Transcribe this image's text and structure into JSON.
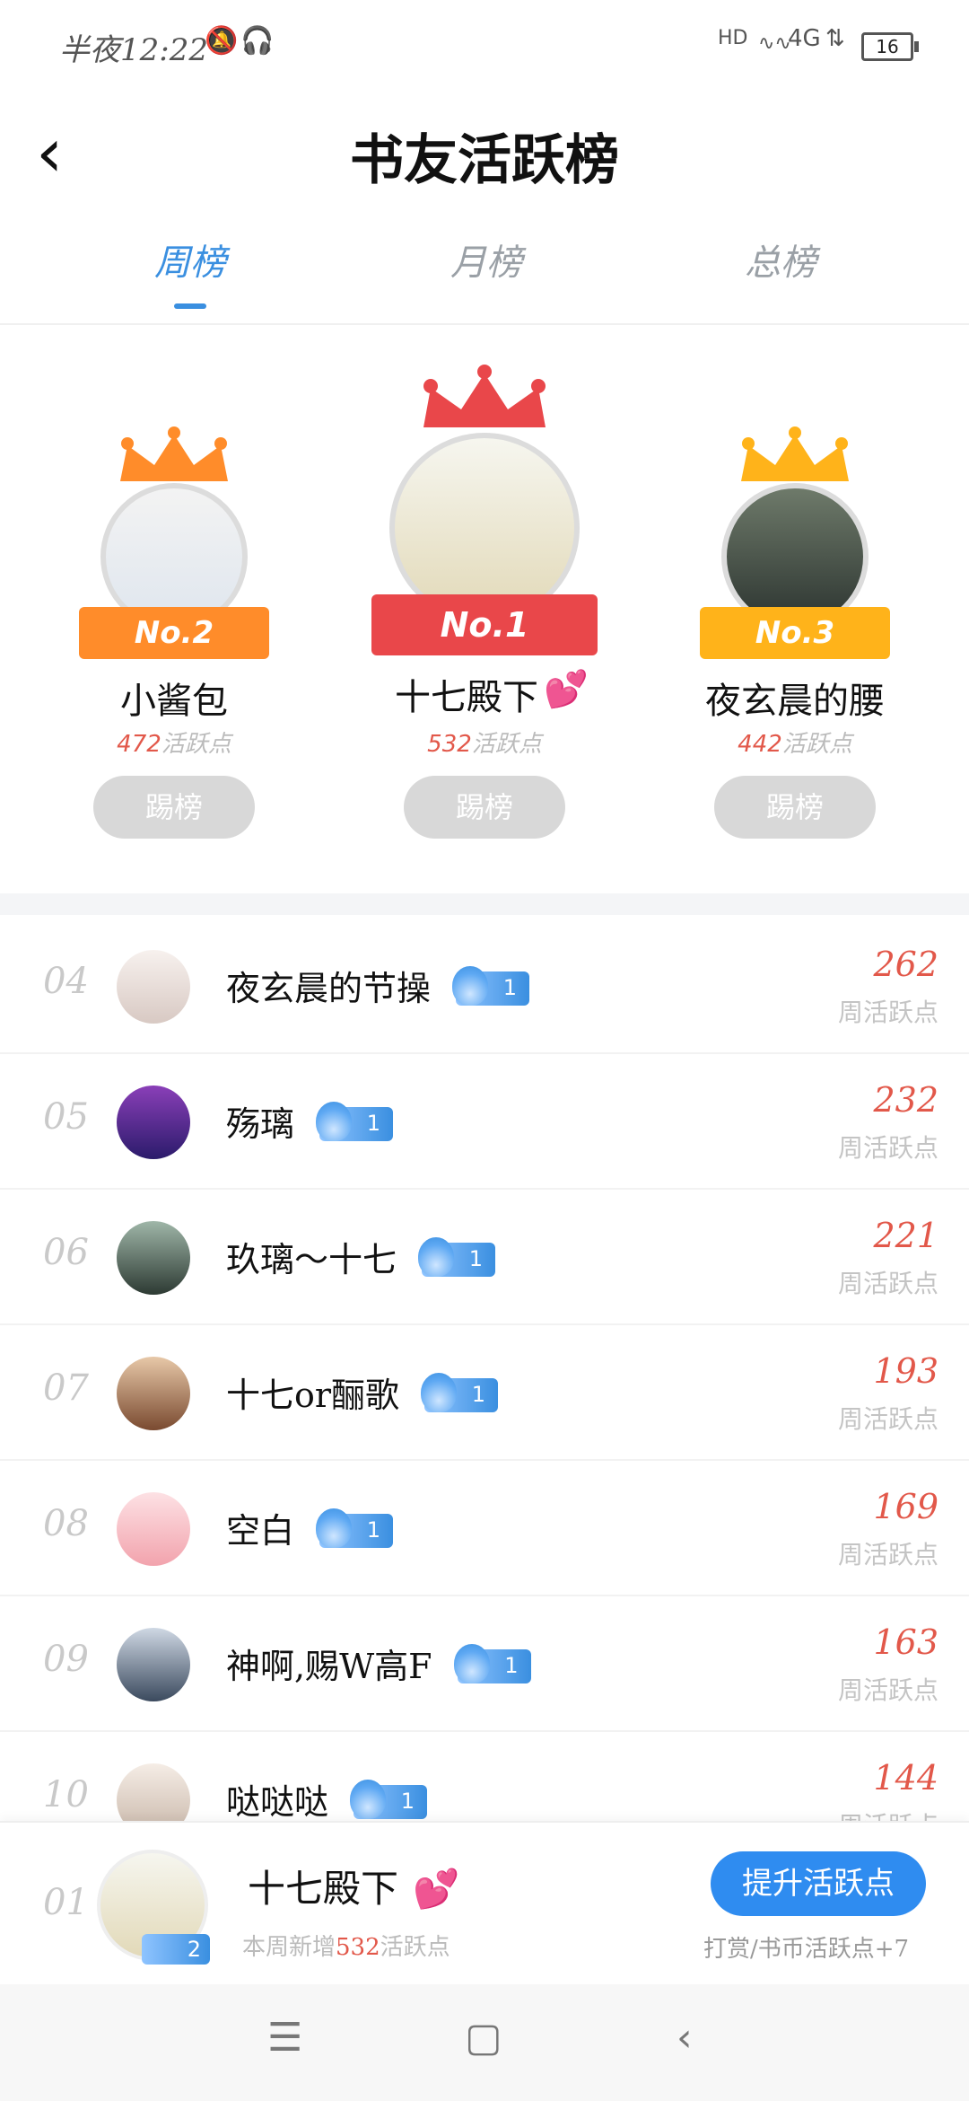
{
  "status_bar": {
    "time": "半夜12:22",
    "net": "HD",
    "signal": "4G",
    "battery": "16"
  },
  "header": {
    "title": "书友活跃榜"
  },
  "tabs": [
    {
      "label": "周榜"
    },
    {
      "label": "月榜"
    },
    {
      "label": "总榜"
    }
  ],
  "podium": [
    {
      "badge": "No.2",
      "name": "小酱包",
      "points": "472",
      "unit": "活跃点",
      "button": "踢榜"
    },
    {
      "badge": "No.1",
      "name": "十七殿下",
      "points": "532",
      "unit": "活跃点",
      "button": "踢榜"
    },
    {
      "badge": "No.3",
      "name": "夜玄晨的腰",
      "points": "442",
      "unit": "活跃点",
      "button": "踢榜"
    }
  ],
  "list": [
    {
      "rank": "04",
      "name": "夜玄晨的节操",
      "badge": "1",
      "value": "262",
      "unit": "周活跃点"
    },
    {
      "rank": "05",
      "name": "殇璃",
      "badge": "1",
      "value": "232",
      "unit": "周活跃点"
    },
    {
      "rank": "06",
      "name": "玖璃～十七",
      "badge": "1",
      "value": "221",
      "unit": "周活跃点"
    },
    {
      "rank": "07",
      "name": "十七or酾歌",
      "badge": "1",
      "value": "193",
      "unit": "周活跃点"
    },
    {
      "rank": "08",
      "name": "空白",
      "badge": "1",
      "value": "169",
      "unit": "周活跃点"
    },
    {
      "rank": "09",
      "name": "神啊,赐W高F",
      "badge": "1",
      "value": "163",
      "unit": "周活跃点"
    },
    {
      "rank": "10",
      "name": "哒哒哒",
      "badge": "1",
      "value": "144",
      "unit": "周活跃点"
    }
  ],
  "me": {
    "rank": "01",
    "name": "十七殿下",
    "badge": "2",
    "sub_prefix": "本周新增",
    "sub_points": "532",
    "sub_suffix": "活跃点",
    "boost_button": "提升活跃点",
    "tip": "打赏/书币活跃点+7"
  },
  "colors": {
    "accent": "#3a8fe0",
    "points": "#e2584a",
    "gold": "#ffb31a",
    "red": "#e9474a",
    "orange": "#ff8c2a"
  }
}
